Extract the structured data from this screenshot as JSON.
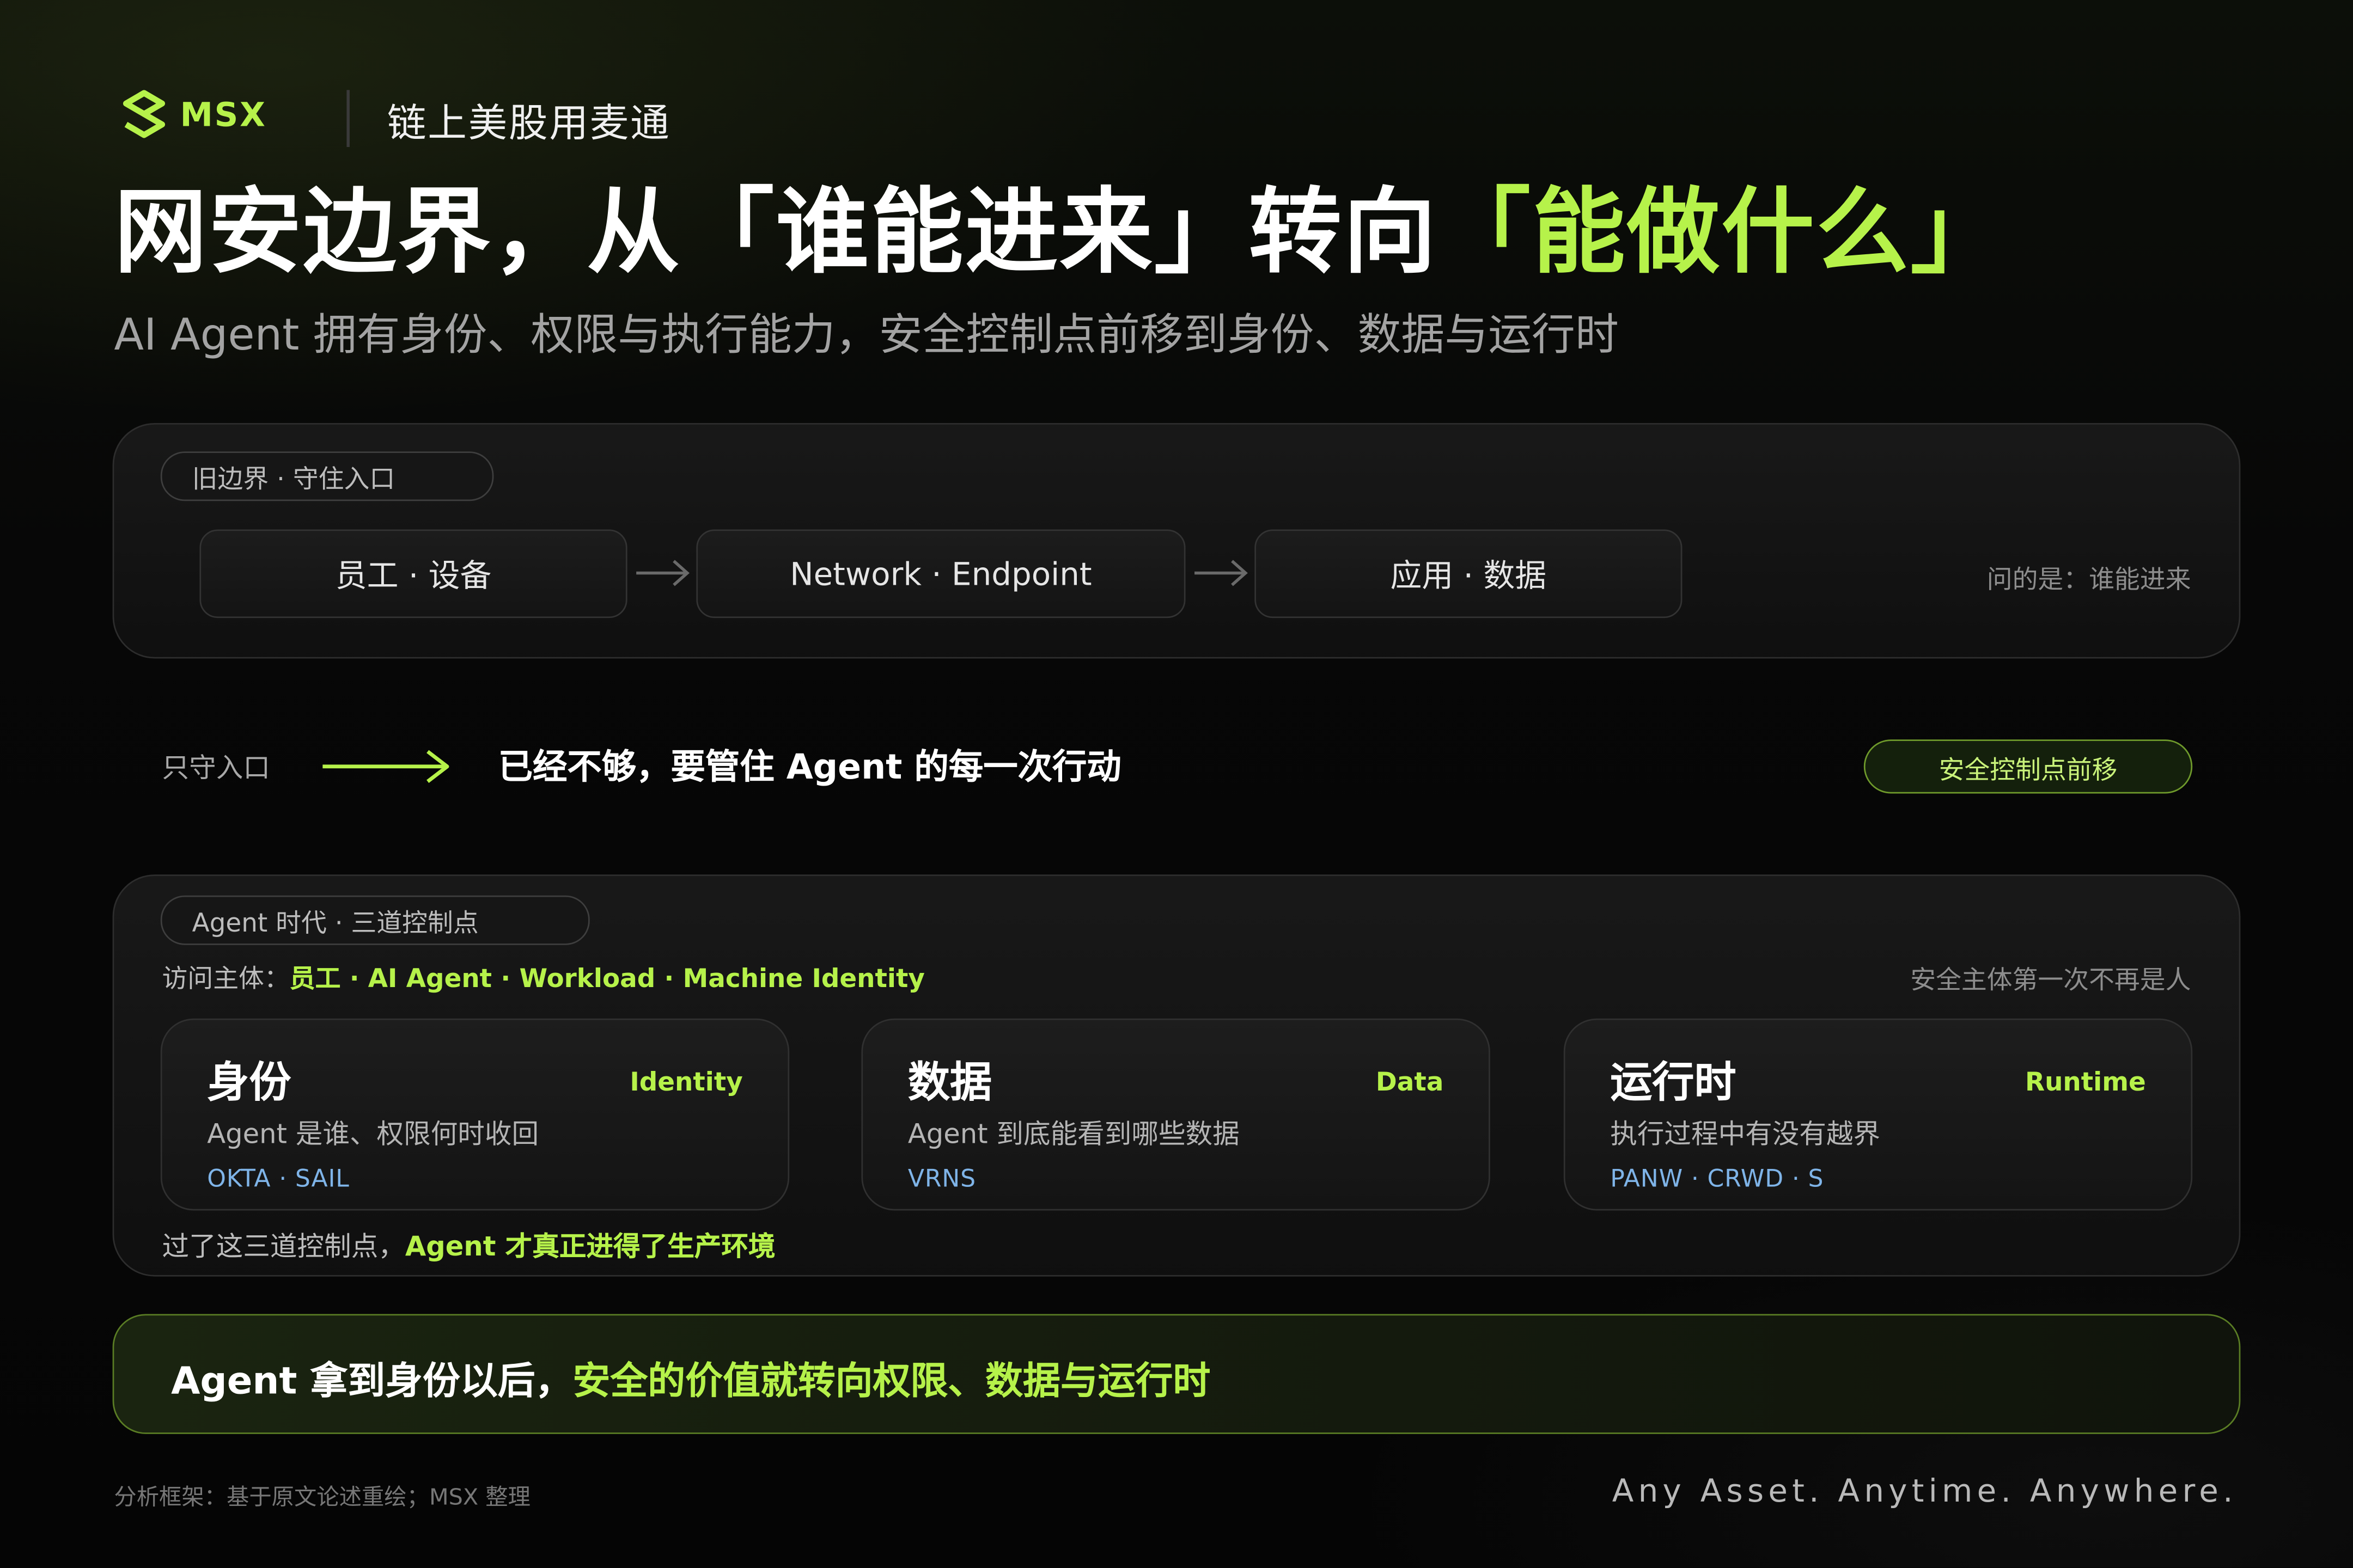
{
  "header": {
    "logo_text": "MSX",
    "tagline": "链上美股用麦通"
  },
  "title": {
    "part1": "网安边界，从「谁能进来」转向",
    "part2": "「能做什么」"
  },
  "subtitle": "AI Agent 拥有身份、权限与执行能力，安全控制点前移到身份、数据与运行时",
  "old_boundary": {
    "label": "旧边界 · 守住入口",
    "flow": [
      "员工 · 设备",
      "Network · Endpoint",
      "应用 · 数据"
    ],
    "question": "问的是：谁能进来"
  },
  "transition": {
    "left_label": "只守入口",
    "statement": "已经不够，要管住 Agent 的每一次行动",
    "badge": "安全控制点前移"
  },
  "agent_era": {
    "label": "Agent 时代 · 三道控制点",
    "access_prefix": "访问主体：",
    "access_subjects": "员工 · AI Agent · Workload · Machine Identity",
    "right_note": "安全主体第一次不再是人",
    "cards": [
      {
        "title": "身份",
        "tag": "Identity",
        "desc": "Agent 是谁、权限何时收回",
        "tickers": "OKTA · SAIL"
      },
      {
        "title": "数据",
        "tag": "Data",
        "desc": "Agent 到底能看到哪些数据",
        "tickers": "VRNS"
      },
      {
        "title": "运行时",
        "tag": "Runtime",
        "desc": "执行过程中有没有越界",
        "tickers": "PANW · CRWD · S"
      }
    ],
    "footer_prefix": "过了这三道控制点，",
    "footer_highlight": "Agent 才真正进得了生产环境"
  },
  "callout": {
    "prefix": "Agent 拿到身份以后，",
    "highlight": "安全的价值就转向权限、数据与运行时"
  },
  "footer": {
    "note": "分析框架：基于原文论述重绘；MSX 整理",
    "slogan": "Any Asset. Anytime. Anywhere."
  },
  "colors": {
    "accent": "#b6f24a",
    "ticker": "#7fb4e8",
    "background": "#060606"
  }
}
